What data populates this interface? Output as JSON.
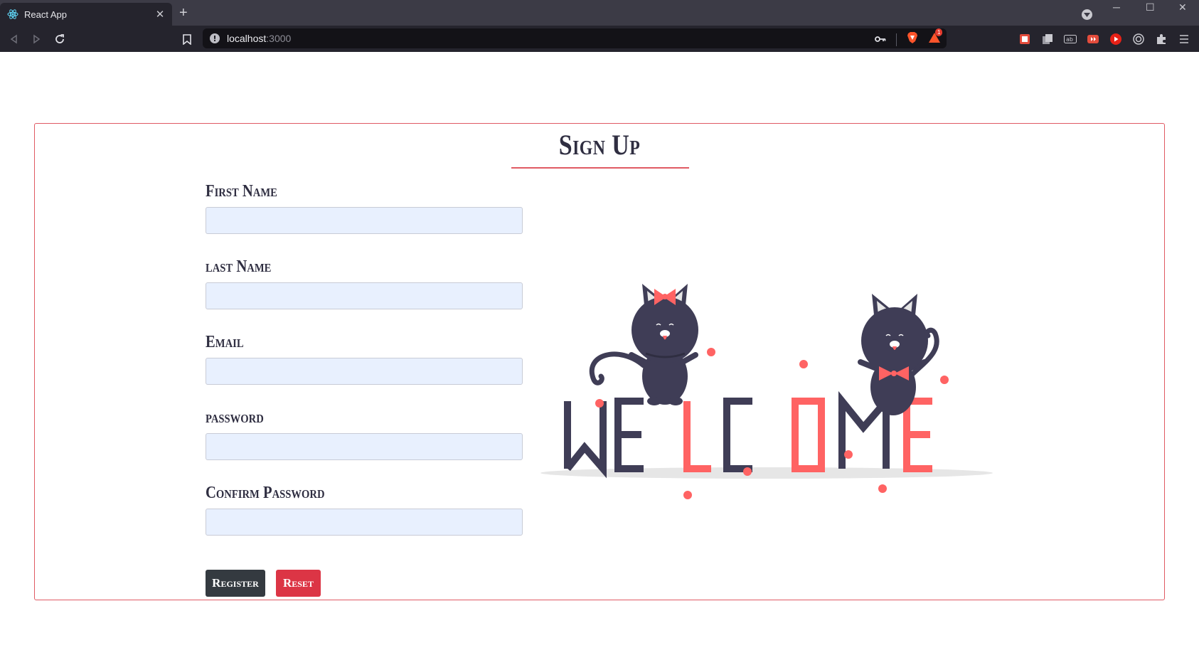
{
  "browser": {
    "tab_title": "React App",
    "url_host": "localhost",
    "url_port": ":3000",
    "badge_count": "1",
    "accent": "#fb542b"
  },
  "form": {
    "title": "Sign Up",
    "fields": [
      {
        "label": "First Name",
        "value": "",
        "type": "text"
      },
      {
        "label": "last Name",
        "value": "",
        "type": "text"
      },
      {
        "label": "Email",
        "value": "",
        "type": "email"
      },
      {
        "label": "password",
        "value": "",
        "type": "password"
      },
      {
        "label": "Confirm Password",
        "value": "",
        "type": "password"
      }
    ],
    "register_label": "Register",
    "reset_label": "Reset"
  },
  "illustration": {
    "subject": "welcome-cats",
    "dark_color": "#3f3d56",
    "accent_color": "#ff6363"
  }
}
